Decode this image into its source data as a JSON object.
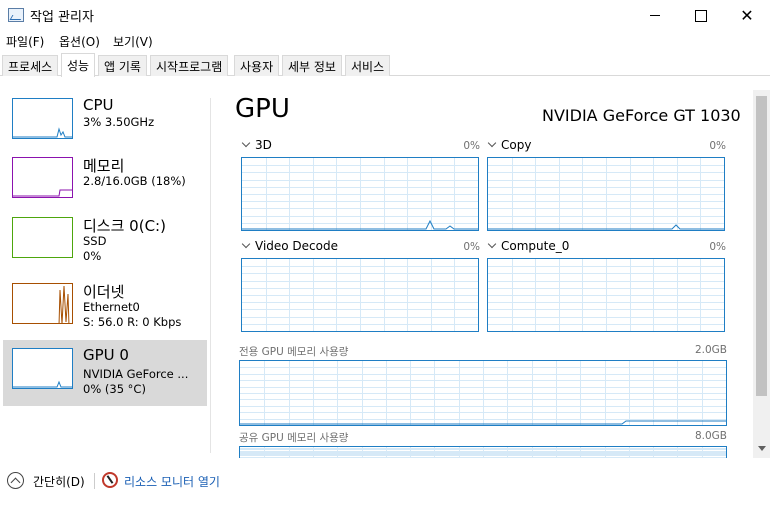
{
  "window": {
    "title": "작업 관리자",
    "close_glyph": "✕"
  },
  "menu": [
    "파일(F)",
    "옵션(O)",
    "보기(V)"
  ],
  "tabs": [
    "프로세스",
    "성능",
    "앱 기록",
    "시작프로그램",
    "사용자",
    "세부 정보",
    "서비스"
  ],
  "active_tab": "성능",
  "sidebar": {
    "items": [
      {
        "name": "CPU",
        "line1": "3% 3.50GHz",
        "line2": "",
        "line3": "",
        "color": "#1f7ec4"
      },
      {
        "name": "메모리",
        "line1": "2.8/16.0GB (18%)",
        "line2": "",
        "line3": "",
        "color": "#8b12ae"
      },
      {
        "name": "디스크 0(C:)",
        "line1": "SSD",
        "line2": "0%",
        "line3": "",
        "color": "#4da60c"
      },
      {
        "name": "이더넷",
        "line1": "Ethernet0",
        "line2": "S:  56.0  R:  0 Kbps",
        "line3": "",
        "color": "#a74f01"
      },
      {
        "name": "GPU 0",
        "line1": "NVIDIA GeForce ...",
        "line2": "0% (35 °C)",
        "line3": "",
        "color": "#1f7ec4"
      }
    ]
  },
  "detail": {
    "title": "GPU",
    "model": "NVIDIA GeForce GT 1030",
    "graphs": [
      {
        "label": "3D",
        "percent": "0%"
      },
      {
        "label": "Copy",
        "percent": "0%"
      },
      {
        "label": "Video Decode",
        "percent": "0%"
      },
      {
        "label": "Compute_0",
        "percent": "0%"
      }
    ],
    "dedicated_memory": {
      "label": "전용 GPU 메모리 사용량",
      "max": "2.0GB"
    },
    "shared_memory": {
      "label": "공유 GPU 메모리 사용량",
      "max": "8.0GB"
    }
  },
  "footer": {
    "fewer_details": "간단히(D)",
    "resource_monitor": "리소스 모니터 열기"
  }
}
